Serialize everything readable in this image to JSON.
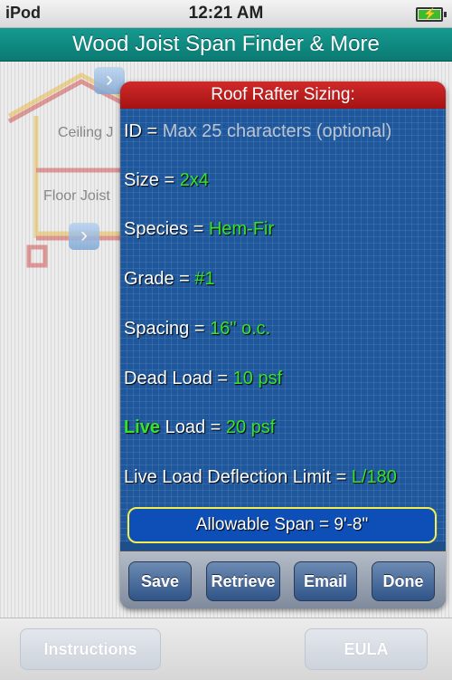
{
  "status": {
    "carrier": "iPod",
    "time": "12:21 AM"
  },
  "app": {
    "title": "Wood Joist Span Finder & More"
  },
  "background": {
    "ceiling_label": "Ceiling J",
    "floor_label": "Floor Joist"
  },
  "panel": {
    "header": "Roof Rafter Sizing:",
    "id_label": "ID = ",
    "id_placeholder": "Max 25 characters (optional)",
    "size_label": "Size = ",
    "size_value": "2x4",
    "species_label": "Species = ",
    "species_value": "Hem-Fir",
    "grade_label": "Grade = ",
    "grade_value": "#1",
    "spacing_label": "Spacing = ",
    "spacing_value": "16\" o.c.",
    "dead_label": "Dead Load = ",
    "dead_value": "10 psf",
    "live_word": "Live",
    "live_label": " Load = ",
    "live_value": "20 psf",
    "deflection_label": "Live Load Deflection Limit = ",
    "deflection_value": "L/180",
    "span_text": "Allowable Span = 9'-8\""
  },
  "toolbar": {
    "save": "Save",
    "retrieve": "Retrieve",
    "email": "Email",
    "done": "Done"
  },
  "bottom": {
    "instructions": "Instructions",
    "eula": "EULA"
  },
  "colors": {
    "title_teal": "#0f8a82",
    "value_green": "#38e22b",
    "panel_blue": "#1e579c",
    "header_red": "#c01d1d"
  }
}
